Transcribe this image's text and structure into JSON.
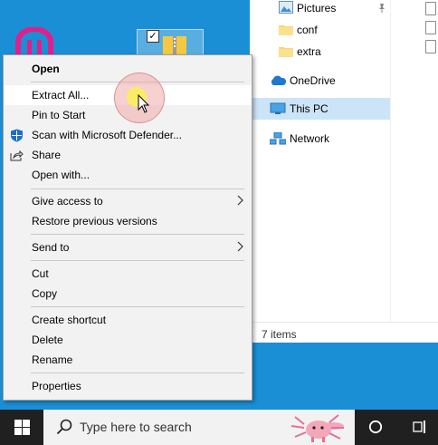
{
  "context_menu": {
    "items": [
      {
        "label": "Open",
        "bold": true
      },
      {
        "label": "Extract All..."
      },
      {
        "label": "Pin to Start"
      },
      {
        "label": "Scan with Microsoft Defender..."
      },
      {
        "label": "Share"
      },
      {
        "label": "Open with..."
      },
      {
        "label": "Give access to"
      },
      {
        "label": "Restore previous versions"
      },
      {
        "label": "Send to"
      },
      {
        "label": "Cut"
      },
      {
        "label": "Copy"
      },
      {
        "label": "Create shortcut"
      },
      {
        "label": "Delete"
      },
      {
        "label": "Rename"
      },
      {
        "label": "Properties"
      }
    ]
  },
  "explorer": {
    "nav": [
      {
        "label": "Pictures",
        "icon": "pictures-icon",
        "pinned": true
      },
      {
        "label": "conf",
        "icon": "folder-icon"
      },
      {
        "label": "extra",
        "icon": "folder-icon"
      },
      {
        "label": "OneDrive",
        "icon": "onedrive-icon"
      },
      {
        "label": "This PC",
        "icon": "this-pc-icon",
        "selected": true
      },
      {
        "label": "Network",
        "icon": "network-icon"
      }
    ],
    "status": "7 items"
  },
  "taskbar": {
    "search_placeholder": "Type here to search"
  },
  "colors": {
    "desktop": "#1a8fd6",
    "menu_bg": "#f2f2f2",
    "selected_nav": "#cce4f7",
    "taskbar": "#202020"
  }
}
